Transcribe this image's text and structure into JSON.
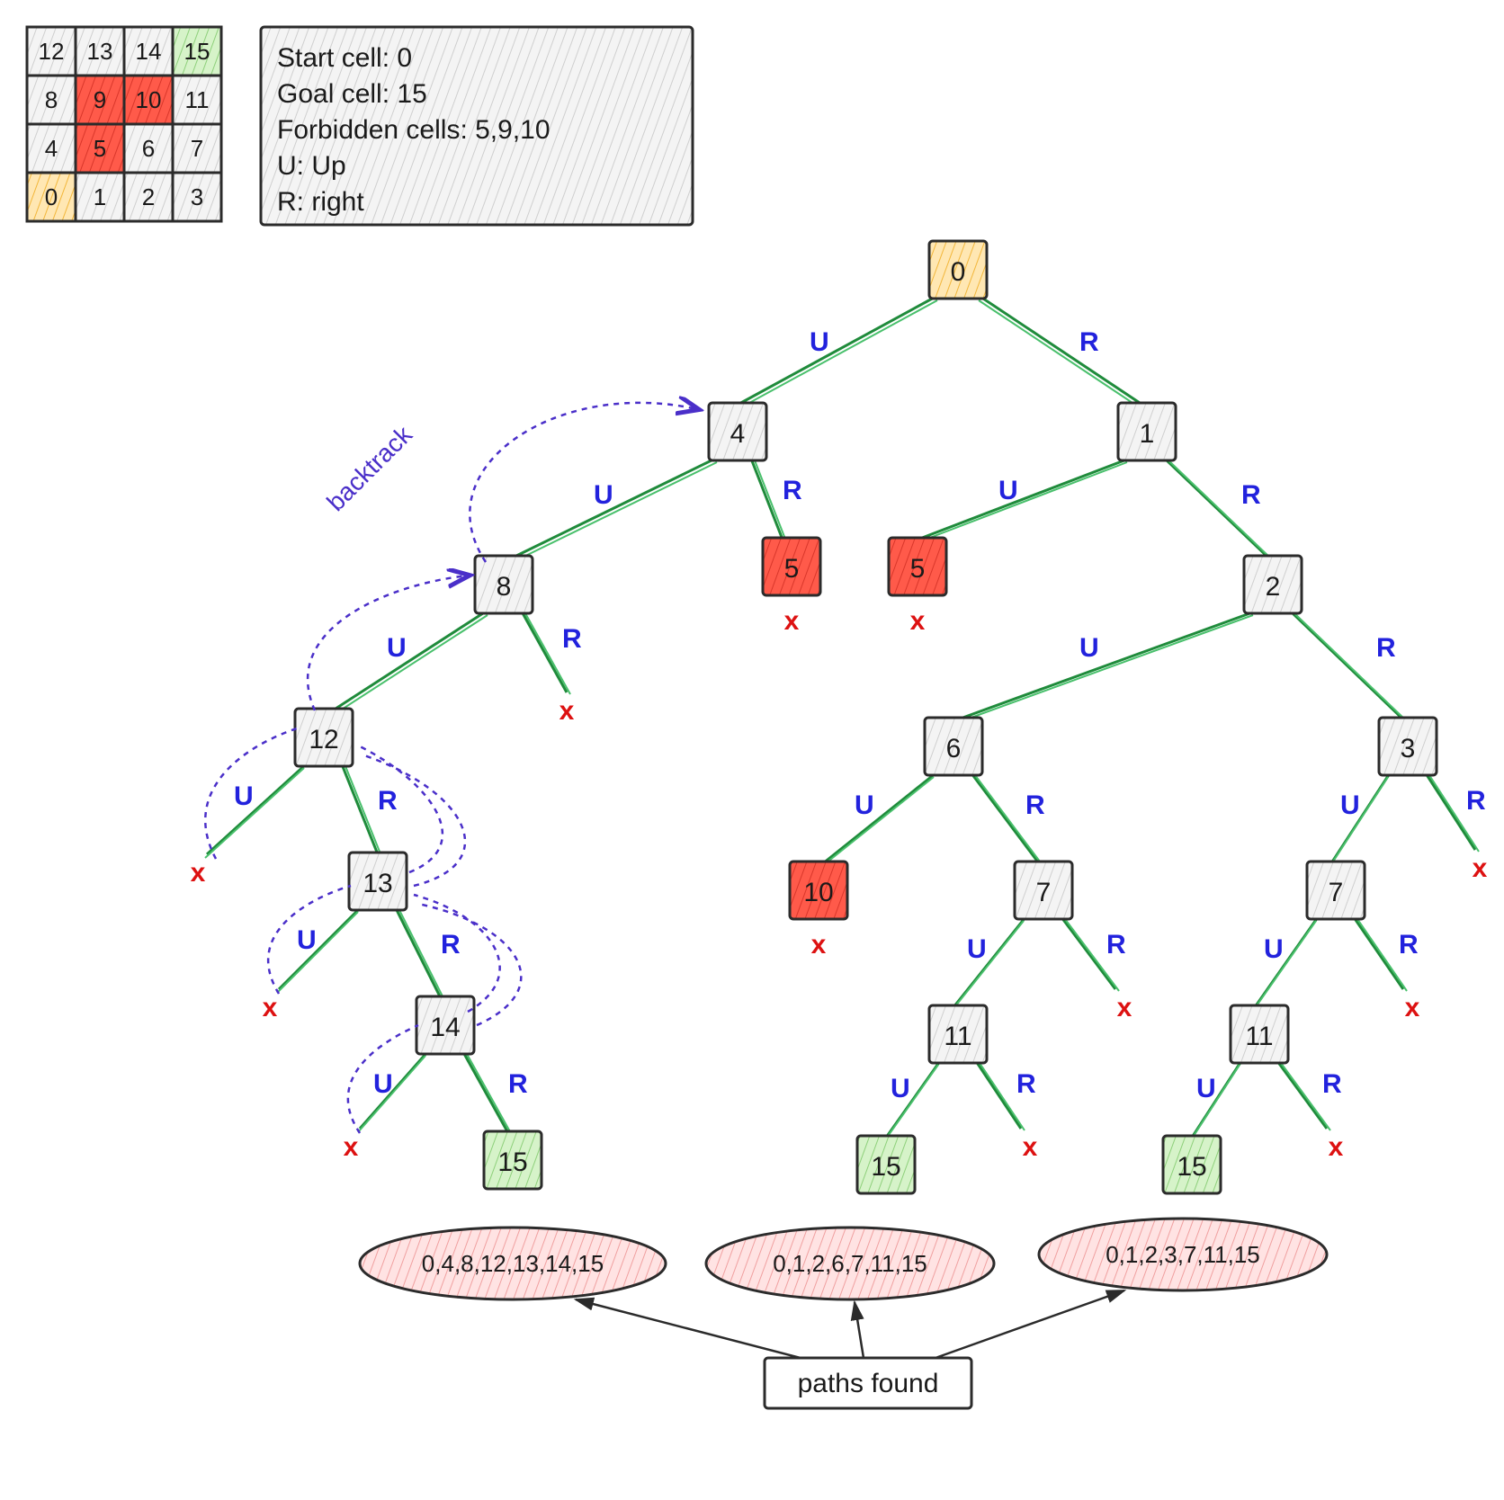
{
  "grid": {
    "rows": [
      [
        12,
        13,
        14,
        15
      ],
      [
        8,
        9,
        10,
        11
      ],
      [
        4,
        5,
        6,
        7
      ],
      [
        0,
        1,
        2,
        3
      ]
    ],
    "start": 0,
    "goal": 15,
    "forbidden": [
      5,
      9,
      10
    ]
  },
  "legend": {
    "line1": "Start cell: 0",
    "line2": "Goal cell: 15",
    "line3": "Forbidden cells: 5,9,10",
    "line4": "U: Up",
    "line5": "R: right"
  },
  "edge_labels": {
    "up": "U",
    "right": "R"
  },
  "backtrack_label": "backtrack",
  "xmark": "x",
  "paths_found_label": "paths found",
  "paths": {
    "p1": "0,4,8,12,13,14,15",
    "p2": "0,1,2,6,7,11,15",
    "p3": "0,1,2,3,7,11,15"
  },
  "tree": {
    "root": 0,
    "nodes_appearing": [
      0,
      4,
      1,
      8,
      5,
      5,
      2,
      12,
      6,
      3,
      13,
      10,
      7,
      7,
      14,
      11,
      11,
      15,
      15,
      15
    ],
    "goal_nodes": [
      15
    ],
    "forbidden_nodes": [
      5,
      10
    ]
  }
}
